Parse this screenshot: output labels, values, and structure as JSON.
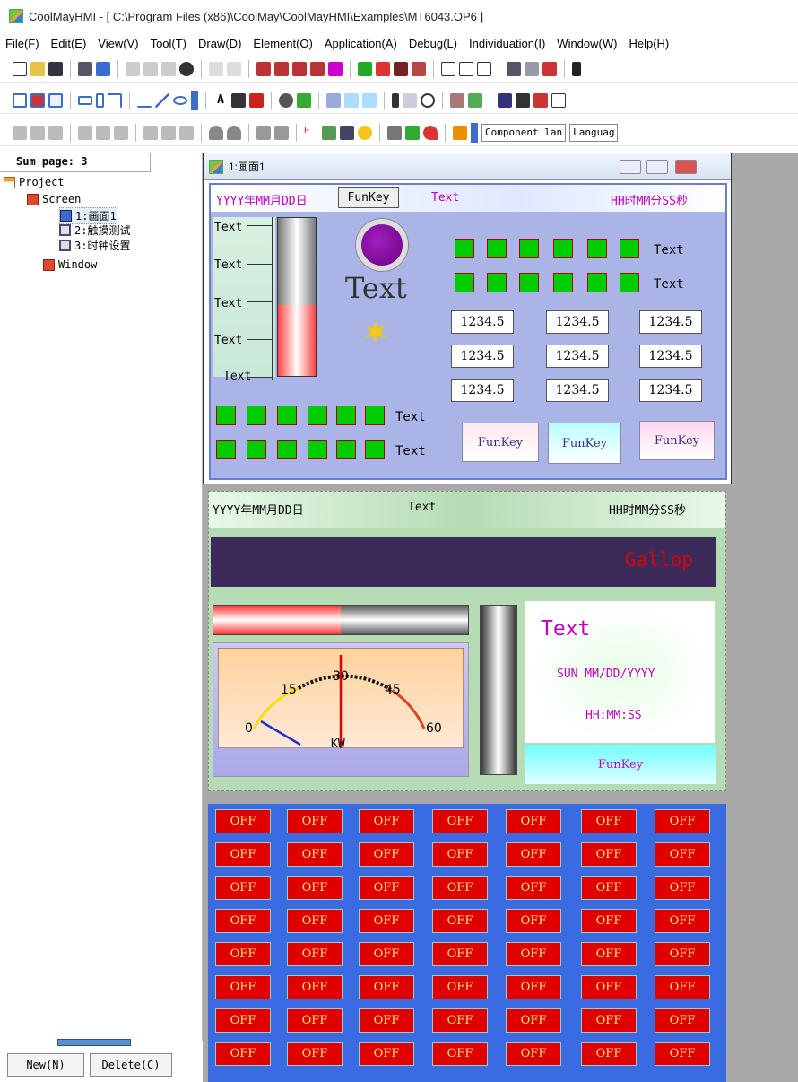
{
  "window": {
    "title": "CoolMayHMI - [ C:\\Program Files (x86)\\CoolMay\\CoolMayHMI\\Examples\\MT6043.OP6 ]"
  },
  "menu": [
    "File(F)",
    "Edit(E)",
    "View(V)",
    "Tool(T)",
    "Draw(D)",
    "Element(O)",
    "Application(A)",
    "Debug(L)",
    "Individuation(I)",
    "Window(W)",
    "Help(H)"
  ],
  "toolbar": {
    "component_lang": "Component lan",
    "language": "Languag"
  },
  "tree": {
    "header": "Sum page: 3",
    "project": "Project",
    "screen": "Screen",
    "pages": [
      "1:画面1",
      "2:触摸测试",
      "3:时钟设置"
    ],
    "window": "Window"
  },
  "buttons": {
    "new": "New(N)",
    "delete": "Delete(C)"
  },
  "screen1": {
    "win_title": "1:画面1",
    "date": "YYYY年MM月DD日",
    "funkey": "FunKey",
    "text": "Text",
    "time": "HH时MM分SS秒",
    "big_text": "Text",
    "values": [
      "1234.5",
      "1234.5",
      "1234.5",
      "1234.5",
      "1234.5",
      "1234.5",
      "1234.5",
      "1234.5",
      "1234.5"
    ],
    "bar_fill": 0.45
  },
  "screen2": {
    "date": "YYYY年MM月DD日",
    "text": "Text",
    "time": "HH时MM分SS秒",
    "marquee": "Gallop",
    "text2": "Text",
    "date2": "SUN MM/DD/YYYY",
    "time2": "HH:MM:SS",
    "funkey": "FunKey",
    "meter": {
      "ticks": [
        "0",
        "15",
        "30",
        "45",
        "60"
      ],
      "unit": "KW",
      "needle": 30
    },
    "hbar_fill": 0.5
  },
  "screen3": {
    "off_label": "OFF"
  },
  "colors": {
    "accent": "#3b6be0",
    "lamp": "#00cc00",
    "off_bg": "#e00000"
  }
}
